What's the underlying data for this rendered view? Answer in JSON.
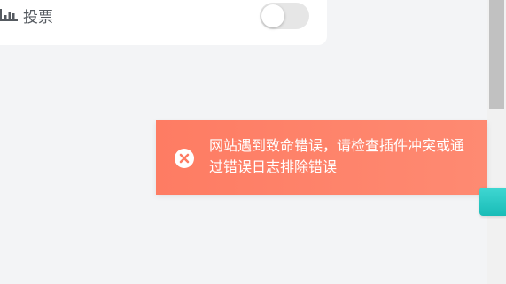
{
  "poll": {
    "label": "投票",
    "icon": "bar-chart-icon",
    "toggle_on": false
  },
  "toast": {
    "message": "网站遇到致命错误，请检查插件冲突或通过错误日志排除错误",
    "icon": "error-close-icon",
    "color": "#fe7c63"
  },
  "side_tab": {
    "color": "#2ccac5"
  }
}
